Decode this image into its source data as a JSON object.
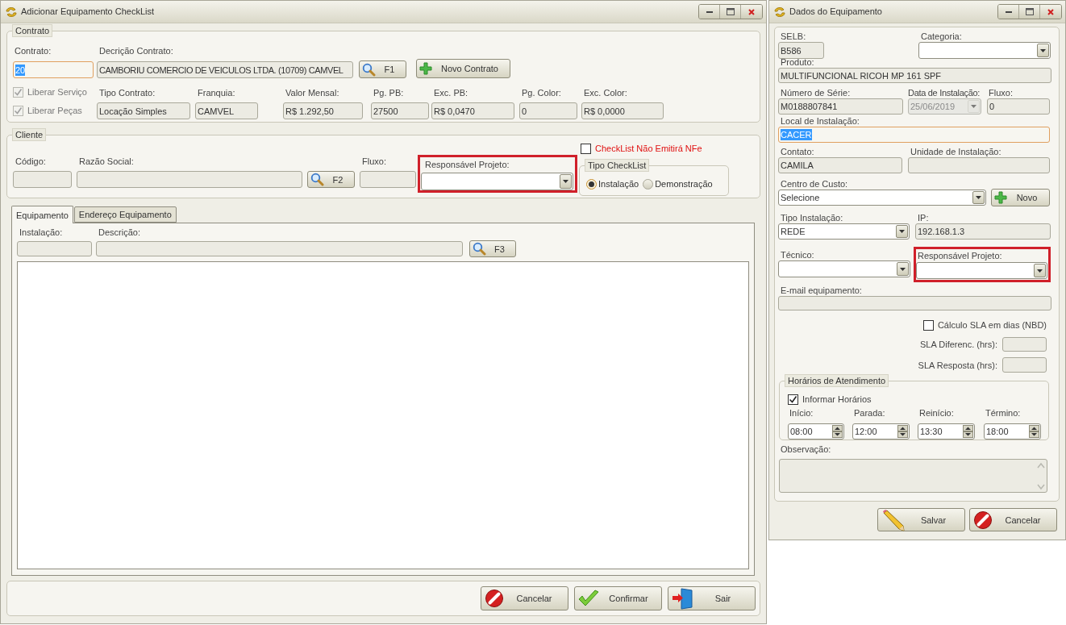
{
  "main_window": {
    "title": "Adicionar Equipamento CheckList",
    "contrato": {
      "legend": "Contrato",
      "fields": [
        {
          "label": "Contrato:",
          "value": "20",
          "focused": true
        },
        {
          "label": "Decrição Contrato:",
          "value": "CAMBORIU COMERCIO DE VEICULOS LTDA. (10709) CAMVEL",
          "focused": false
        }
      ],
      "search_button": "F1",
      "new_button": "Novo Contrato",
      "checkboxes": [
        {
          "label": "Liberar Serviço",
          "checked": true,
          "disabled": true
        },
        {
          "label": "Liberar Peças",
          "checked": true,
          "disabled": true
        }
      ],
      "details": [
        {
          "label": "Tipo Contrato:",
          "value": "Locação Simples"
        },
        {
          "label": "Franquia:",
          "value": "CAMVEL"
        },
        {
          "label": "Valor Mensal:",
          "value": "R$ 1.292,50"
        },
        {
          "label": "Pg. PB:",
          "value": "27500"
        },
        {
          "label": "Exc. PB:",
          "value": "R$ 0,0470"
        },
        {
          "label": "Pg. Color:",
          "value": "0"
        },
        {
          "label": "Exc. Color:",
          "value": "R$ 0,0000"
        }
      ]
    },
    "cliente": {
      "legend": "Cliente",
      "nfe_checkbox": {
        "label": "CheckList Não Emitirá NFe",
        "checked": false
      },
      "codigo_label": "Código:",
      "razao_label": "Razão Social:",
      "search_button": "F2",
      "fluxo_label": "Fluxo:",
      "responsavel": {
        "label": "Responsável Projeto:",
        "highlighted": true
      },
      "tipo_checklist": {
        "legend": "Tipo CheckList",
        "options": [
          {
            "label": "Instalação",
            "selected": true
          },
          {
            "label": "Demonstração",
            "selected": false
          }
        ]
      }
    },
    "tabs": [
      {
        "label": "Equipamento",
        "selected": true
      },
      {
        "label": "Endereço Equipamento",
        "selected": false
      }
    ],
    "equipamento_tab": {
      "instalacao_label": "Instalação:",
      "descricao_label": "Descrição:",
      "search_button": "F3"
    },
    "buttons": [
      {
        "label": "Cancelar",
        "kind": "cancel"
      },
      {
        "label": "Confirmar",
        "kind": "confirm"
      },
      {
        "label": "Sair",
        "kind": "exit"
      }
    ]
  },
  "equipment_window": {
    "title": "Dados do Equipamento",
    "selb": {
      "label": "SELB:",
      "value": "B586"
    },
    "categoria": {
      "label": "Categoria:"
    },
    "produto": {
      "label": "Produto:",
      "value": "MULTIFUNCIONAL RICOH MP 161 SPF"
    },
    "numero_serie": {
      "label": "Número de Série:",
      "value": "M0188807841"
    },
    "data_instalacao": {
      "label": "Data de Instalação:",
      "value": "25/06/2019",
      "disabled": true
    },
    "fluxo": {
      "label": "Fluxo:",
      "value": "0"
    },
    "local": {
      "label": "Local de Instalação:",
      "value": "CACER",
      "focused": true
    },
    "contato": {
      "label": "Contato:",
      "value": "CAMILA"
    },
    "unidade": {
      "label": "Unidade de Instalação:"
    },
    "centro_custo": {
      "label": "Centro de Custo:",
      "value": "Selecione"
    },
    "new_button": "Novo",
    "tipo_instalacao": {
      "label": "Tipo Instalação:",
      "value": "REDE"
    },
    "ip": {
      "label": "IP:",
      "value": "192.168.1.3"
    },
    "tecnico": {
      "label": "Técnico:"
    },
    "responsavel": {
      "label": "Responsável Projeto:",
      "highlighted": true
    },
    "email": {
      "label": "E-mail equipamento:"
    },
    "sla_checkbox": {
      "label": "Cálculo SLA em dias (NBD)",
      "checked": false
    },
    "sla_diferenc": {
      "label": "SLA Diferenc. (hrs):"
    },
    "sla_resposta": {
      "label": "SLA Resposta (hrs):"
    },
    "horarios": {
      "legend": "Horários de Atendimento",
      "checkbox": {
        "label": "Informar Horários",
        "checked": true
      },
      "times": [
        {
          "label": "Início:",
          "value": "08:00"
        },
        {
          "label": "Parada:",
          "value": "12:00"
        },
        {
          "label": "Reinício:",
          "value": "13:30"
        },
        {
          "label": "Término:",
          "value": "18:00"
        }
      ]
    },
    "observacao": {
      "label": "Observação:"
    },
    "buttons": [
      {
        "label": "Salvar",
        "kind": "save"
      },
      {
        "label": "Cancelar",
        "kind": "cancel"
      }
    ]
  }
}
